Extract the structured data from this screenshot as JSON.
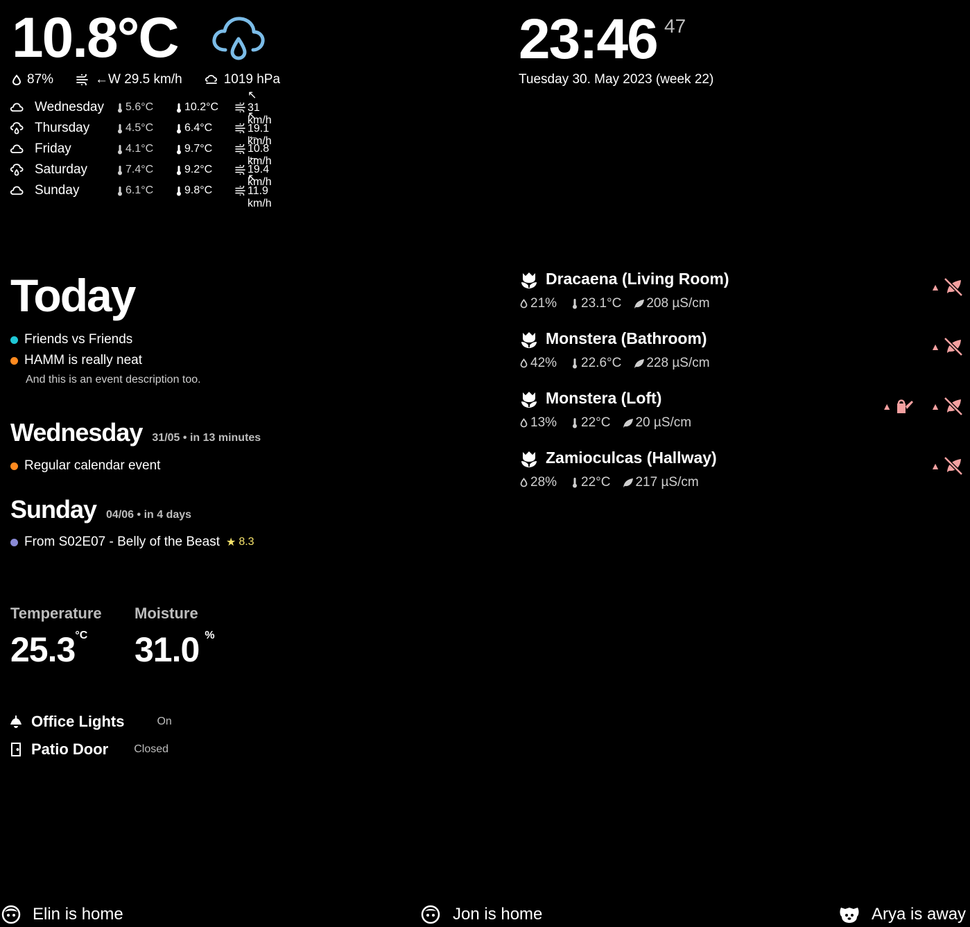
{
  "colors": {
    "background": "#000000",
    "text": "#ffffff",
    "muted": "#bdbdbd",
    "rain_icon": "#7bbce8",
    "alert": "#f4a0a0",
    "star": "#f5e26b"
  },
  "weather": {
    "temperature": "10.8°C",
    "icon": "cloud-rain-icon",
    "humidity": "87%",
    "wind": "←W 29.5 km/h",
    "pressure": "1019 hPa",
    "forecast": [
      {
        "day": "Wednesday",
        "icon": "cloud-icon",
        "low": "5.6°C",
        "high": "10.2°C",
        "wind": "↖ 31 km/h"
      },
      {
        "day": "Thursday",
        "icon": "cloud-rain-icon",
        "low": "4.5°C",
        "high": "6.4°C",
        "wind": "↖ 19.1 km/h"
      },
      {
        "day": "Friday",
        "icon": "cloud-icon",
        "low": "4.1°C",
        "high": "9.7°C",
        "wind": "← 10.8 km/h"
      },
      {
        "day": "Saturday",
        "icon": "cloud-rain-icon",
        "low": "7.4°C",
        "high": "9.2°C",
        "wind": "← 19.4 km/h"
      },
      {
        "day": "Sunday",
        "icon": "cloud-icon",
        "low": "6.1°C",
        "high": "9.8°C",
        "wind": "↖ 11.9 km/h"
      }
    ]
  },
  "clock": {
    "time": "23:46",
    "seconds": "47",
    "date": "Tuesday 30. May 2023",
    "week": "(week 22)"
  },
  "calendar": {
    "today_title": "Today",
    "today_events": [
      {
        "title": "Friends vs Friends",
        "color": "#1fc8d6"
      },
      {
        "title": "HAMM is really neat",
        "color": "#ff8a1f",
        "description": "And this is an event description too."
      }
    ],
    "days": [
      {
        "name": "Wednesday",
        "meta": "31/05 • in 13 minutes",
        "events": [
          {
            "title": "Regular calendar event",
            "color": "#ff8a1f"
          }
        ]
      },
      {
        "name": "Sunday",
        "meta": "04/06 • in 4 days",
        "events": [
          {
            "title": "From S02E07 - Belly of the Beast",
            "color": "#8a8ad6",
            "rating": "8.3"
          }
        ]
      }
    ]
  },
  "sensors": [
    {
      "label": "Temperature",
      "value": "25.3",
      "unit": "°C"
    },
    {
      "label": "Moisture",
      "value": "31.0",
      "unit": "%"
    }
  ],
  "devices": [
    {
      "name": "Office Lights",
      "state": "On",
      "icon": "ceiling-light-icon"
    },
    {
      "name": "Patio Door",
      "state": "Closed",
      "icon": "door-icon"
    }
  ],
  "plants": [
    {
      "name": "Dracaena (Living Room)",
      "moisture": "21%",
      "temperature": "23.1°C",
      "conductivity": "208 µS/cm",
      "alerts": [
        "low-conductivity"
      ]
    },
    {
      "name": "Monstera (Bathroom)",
      "moisture": "42%",
      "temperature": "22.6°C",
      "conductivity": "228 µS/cm",
      "alerts": [
        "low-conductivity"
      ]
    },
    {
      "name": "Monstera (Loft)",
      "moisture": "13%",
      "temperature": "22°C",
      "conductivity": "20 µS/cm",
      "alerts": [
        "needs-water",
        "low-conductivity"
      ]
    },
    {
      "name": "Zamioculcas (Hallway)",
      "moisture": "28%",
      "temperature": "22°C",
      "conductivity": "217 µS/cm",
      "alerts": [
        "low-conductivity"
      ]
    }
  ],
  "presence": [
    {
      "name": "Elin is home",
      "icon": "face-icon"
    },
    {
      "name": "Jon is home",
      "icon": "face-icon"
    },
    {
      "name": "Arya is away",
      "icon": "dog-icon"
    }
  ]
}
